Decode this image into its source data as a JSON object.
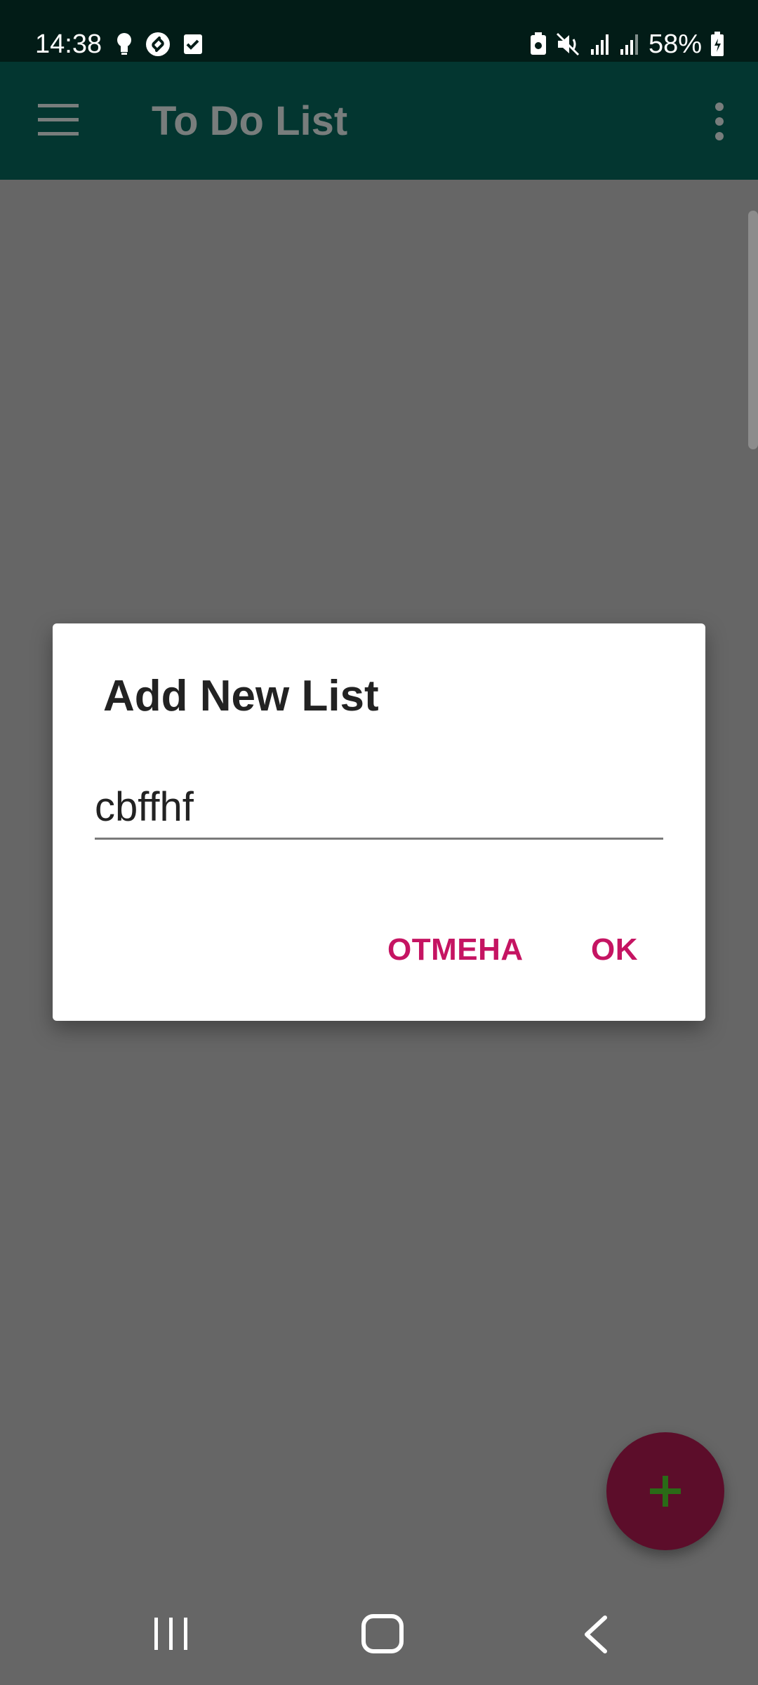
{
  "status_bar": {
    "time": "14:38",
    "battery": "58%",
    "left_icons": [
      "bulb-icon",
      "shazam-icon",
      "checkbox-icon"
    ],
    "right_icons": [
      "battery-saver-icon",
      "mute-icon",
      "signal-icon",
      "signal-icon",
      "battery-icon"
    ]
  },
  "app_bar": {
    "title": "To Do List",
    "menu_icon": "hamburger-menu-icon",
    "overflow_icon": "more-vert-icon",
    "background": "#033630"
  },
  "dialog": {
    "title": "Add New List",
    "input_value": "cbffhf",
    "cancel_label": "ОТМЕНА",
    "ok_label": "OK",
    "accent": "#c51462"
  },
  "fab": {
    "icon": "plus-icon",
    "background": "#5c0d2a",
    "icon_color": "#2a6b17"
  },
  "nav_bar": {
    "icons": [
      "recents-icon",
      "home-icon",
      "back-icon"
    ]
  }
}
